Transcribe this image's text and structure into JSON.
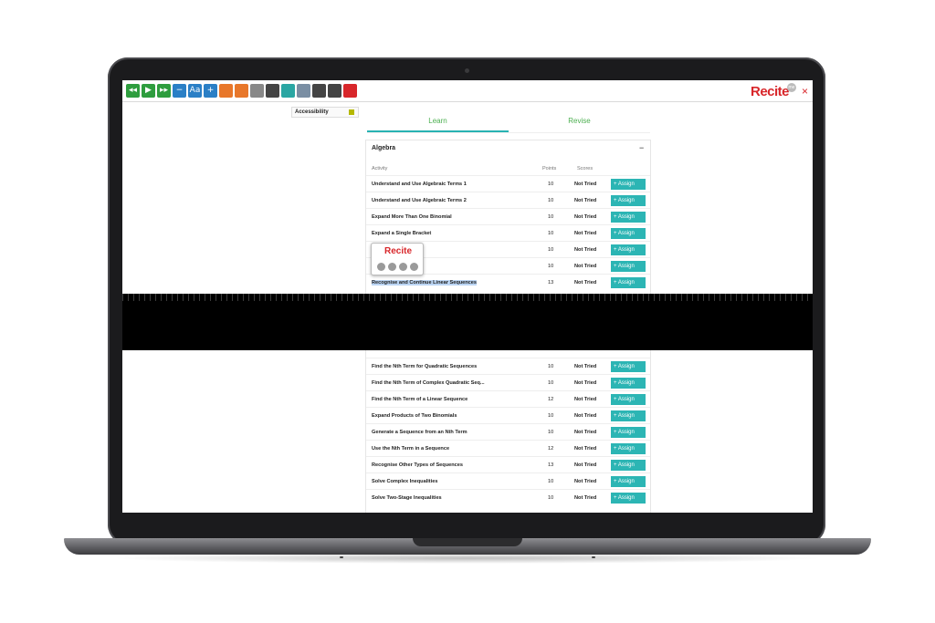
{
  "toolbar": {
    "buttons": [
      {
        "name": "rewind-icon",
        "glyph": "◂◂",
        "color": "#2e9d3e"
      },
      {
        "name": "play-icon",
        "glyph": "▶",
        "color": "#2e9d3e"
      },
      {
        "name": "fast-forward-icon",
        "glyph": "▸▸",
        "color": "#2e9d3e"
      },
      {
        "name": "decrease-text-icon",
        "glyph": "−",
        "color": "#2a7fc6"
      },
      {
        "name": "font-icon",
        "glyph": "Aa",
        "color": "#2a7fc6"
      },
      {
        "name": "increase-text-icon",
        "glyph": "+",
        "color": "#2a7fc6"
      },
      {
        "name": "color-wheel-icon",
        "glyph": "",
        "color": "#e8772a"
      },
      {
        "name": "highlight-bar-icon",
        "glyph": "",
        "color": "#e8772a"
      },
      {
        "name": "ruler-icon",
        "glyph": "",
        "color": "#888888"
      },
      {
        "name": "translate-icon",
        "glyph": "",
        "color": "#444444"
      },
      {
        "name": "document-icon",
        "glyph": "",
        "color": "#2aa6a3"
      },
      {
        "name": "search-icon",
        "glyph": "",
        "color": "#7a8ea3"
      },
      {
        "name": "gear-icon",
        "glyph": "",
        "color": "#444444"
      },
      {
        "name": "reset-icon",
        "glyph": "",
        "color": "#444444"
      },
      {
        "name": "pdf-icon",
        "glyph": "",
        "color": "#d8262a"
      }
    ],
    "brand": "Recite",
    "close_glyph": "×"
  },
  "accessibility": {
    "label": "Accessibility"
  },
  "tabs": [
    {
      "label": "Learn"
    },
    {
      "label": "Revise"
    }
  ],
  "section": {
    "title": "Algebra",
    "toggle": "−"
  },
  "headers": {
    "activity": "Activity",
    "points": "Points",
    "scores": "Scores"
  },
  "popup": {
    "brand": "Recite"
  },
  "assign_label": "+  Assign",
  "rows_top": [
    {
      "name": "Understand and Use Algebraic Terms 1",
      "points": "10",
      "score": "Not Tried"
    },
    {
      "name": "Understand and Use Algebraic Terms 2",
      "points": "10",
      "score": "Not Tried"
    },
    {
      "name": "Expand More Than One Binomial",
      "points": "10",
      "score": "Not Tried"
    },
    {
      "name": "Expand a Single Bracket",
      "points": "10",
      "score": "Not Tried"
    },
    {
      "name": "quations",
      "points": "10",
      "score": "Not Tried"
    },
    {
      "name": "ualities",
      "points": "10",
      "score": "Not Tried"
    },
    {
      "name": "Recognise and Continue Linear Sequences",
      "points": "13",
      "score": "Not Tried"
    }
  ],
  "rows_bottom": [
    {
      "name": "Find the Nth Term for Quadratic Sequences",
      "points": "10",
      "score": "Not Tried"
    },
    {
      "name": "Find the Nth Term of Complex Quadratic Seq...",
      "points": "10",
      "score": "Not Tried"
    },
    {
      "name": "Find the Nth Term of a Linear Sequence",
      "points": "12",
      "score": "Not Tried"
    },
    {
      "name": "Expand Products of Two Binomials",
      "points": "10",
      "score": "Not Tried"
    },
    {
      "name": "Generate a Sequence from an Nth Term",
      "points": "10",
      "score": "Not Tried"
    },
    {
      "name": "Use the Nth Term in a Sequence",
      "points": "12",
      "score": "Not Tried"
    },
    {
      "name": "Recognise Other Types of Sequences",
      "points": "13",
      "score": "Not Tried"
    },
    {
      "name": "Solve Complex Inequalities",
      "points": "10",
      "score": "Not Tried"
    },
    {
      "name": "Solve Two-Stage Inequalities",
      "points": "10",
      "score": "Not Tried"
    }
  ]
}
